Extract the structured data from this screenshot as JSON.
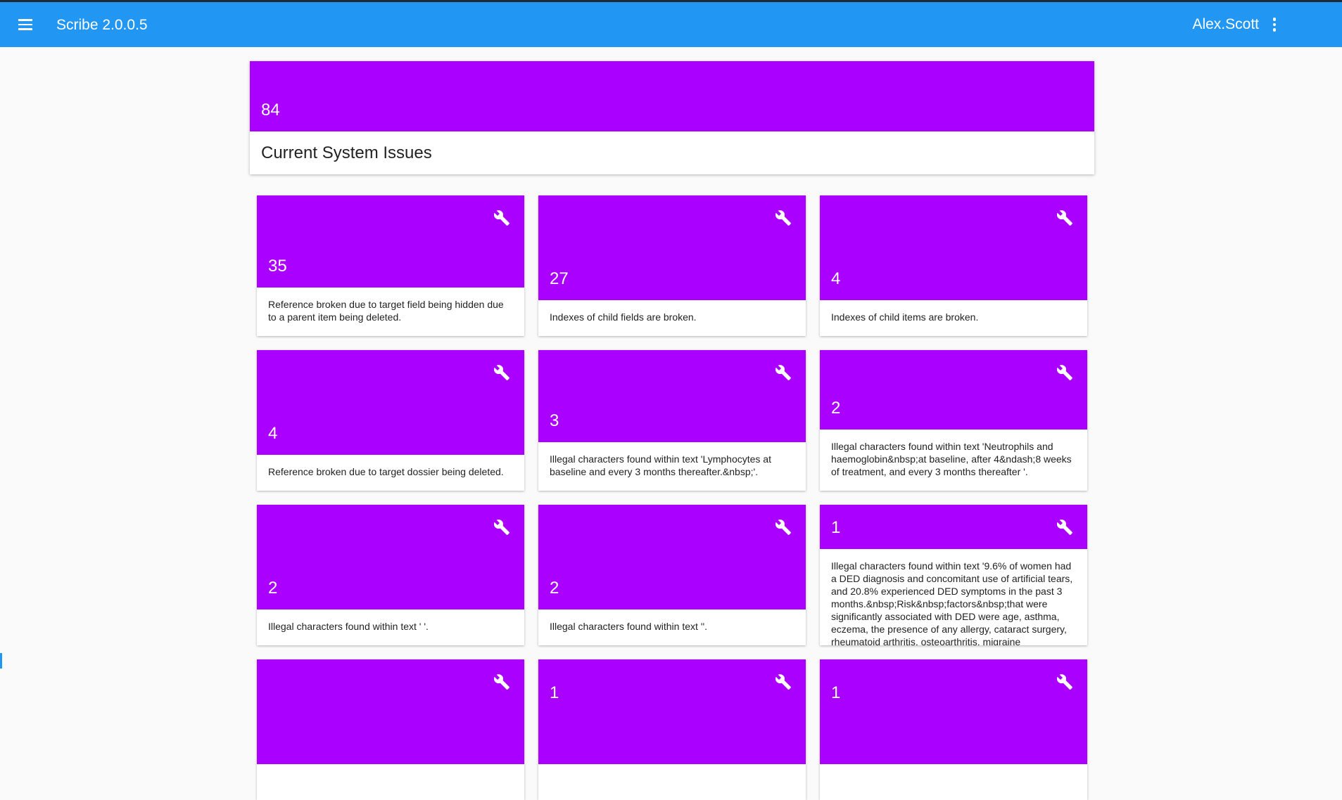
{
  "app": {
    "title": "Scribe 2.0.0.5",
    "user": "Alex.Scott"
  },
  "summary": {
    "count": "84",
    "title": "Current System Issues"
  },
  "colors": {
    "appbar": "#2196f3",
    "accent": "#aa00ff"
  },
  "issues": [
    {
      "count": "35",
      "text": "Reference broken due to target field being hidden due to a parent item being deleted."
    },
    {
      "count": "27",
      "text": "Indexes of child fields are broken."
    },
    {
      "count": "4",
      "text": "Indexes of child items are broken."
    },
    {
      "count": "4",
      "text": "Reference broken due to target dossier being deleted."
    },
    {
      "count": "3",
      "text": "Illegal characters found within text 'Lymphocytes at baseline and every 3 months thereafter.&nbsp;'."
    },
    {
      "count": "2",
      "text": "Illegal characters found within text 'Neutrophils and haemoglobin&nbsp;at baseline, after 4&ndash;8 weeks of treatment, and every 3 months thereafter '."
    },
    {
      "count": "2",
      "text": "Illegal characters found within text ' '."
    },
    {
      "count": "2",
      "text": "Illegal characters found within text ''."
    },
    {
      "count": "1",
      "text": "Illegal characters found within text '9.6% of women had a DED diagnosis and concomitant use of artificial tears, and 20.8% experienced DED symptoms in the past 3 months.&nbsp;Risk&nbsp;factors&nbsp;that were significantly associated with DED were age, asthma, eczema, the presence of any allergy, cataract surgery, rheumatoid arthritis, osteoarthritis, migraine"
    },
    {
      "count": "",
      "text": ""
    },
    {
      "count": "1",
      "text": ""
    },
    {
      "count": "1",
      "text": ""
    }
  ]
}
